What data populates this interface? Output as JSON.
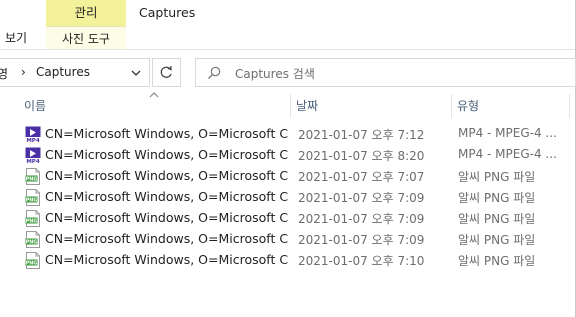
{
  "ribbon": {
    "contextual_group": "관리",
    "window_title": "Captures",
    "tab_view": "보기",
    "tab_photo_tools": "사진 도구"
  },
  "address": {
    "previous_crumb": "영",
    "separator": "›",
    "current": "Captures"
  },
  "search": {
    "placeholder": "Captures 검색"
  },
  "columns": {
    "name": "이름",
    "date": "날짜",
    "type": "유형"
  },
  "files": [
    {
      "name": "CN=Microsoft Windows, O=Microsoft Cor...",
      "date": "2021-01-07 오후 7:12",
      "type": "MP4 - MPEG-4 ...",
      "icon": "mp4-video-icon"
    },
    {
      "name": "CN=Microsoft Windows, O=Microsoft Cor...",
      "date": "2021-01-07 오후 8:20",
      "type": "MP4 - MPEG-4 ...",
      "icon": "mp4-video-icon"
    },
    {
      "name": "CN=Microsoft Windows, O=Microsoft Cor...",
      "date": "2021-01-07 오후 7:07",
      "type": "알씨 PNG 파일",
      "icon": "png-image-icon"
    },
    {
      "name": "CN=Microsoft Windows, O=Microsoft Cor...",
      "date": "2021-01-07 오후 7:09",
      "type": "알씨 PNG 파일",
      "icon": "png-image-icon"
    },
    {
      "name": "CN=Microsoft Windows, O=Microsoft Cor...",
      "date": "2021-01-07 오후 7:09",
      "type": "알씨 PNG 파일",
      "icon": "png-image-icon"
    },
    {
      "name": "CN=Microsoft Windows, O=Microsoft Cor...",
      "date": "2021-01-07 오후 7:09",
      "type": "알씨 PNG 파일",
      "icon": "png-image-icon"
    },
    {
      "name": "CN=Microsoft Windows, O=Microsoft Cor...",
      "date": "2021-01-07 오후 7:10",
      "type": "알씨 PNG 파일",
      "icon": "png-image-icon"
    }
  ],
  "colors": {
    "contextual_tab": "#f4f19b",
    "mp4_icon": "#4b2fa6",
    "png_icon": "#3d9a3d",
    "header_text": "#4c607a"
  }
}
